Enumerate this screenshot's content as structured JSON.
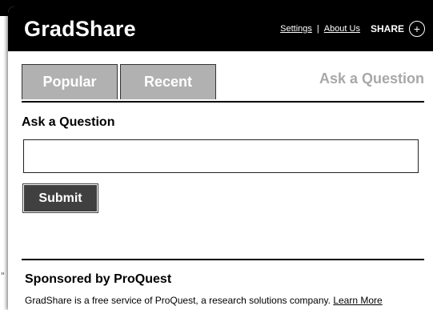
{
  "header": {
    "brand": "GradShare",
    "links": {
      "settings": "Settings",
      "separator": "|",
      "about": "About Us"
    },
    "share_label": "SHARE",
    "share_icon": "+"
  },
  "tabs": {
    "popular": "Popular",
    "recent": "Recent",
    "ask": "Ask a Question"
  },
  "ask_section": {
    "title": "Ask a Question",
    "input_value": "",
    "submit_label": "Submit"
  },
  "sponsor": {
    "title": "Sponsored by ProQuest",
    "text": "GradShare is a free service of ProQuest, a research solutions company.",
    "learn_more": "Learn More"
  },
  "colors": {
    "header_bg": "#000000",
    "tab_bg": "#b1b1b1",
    "tab_active_text": "#a8a8a8",
    "submit_bg": "#404040"
  }
}
